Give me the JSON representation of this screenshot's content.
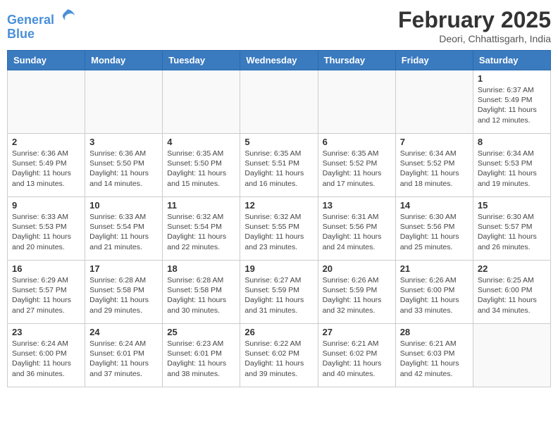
{
  "header": {
    "logo_line1": "General",
    "logo_line2": "Blue",
    "month_title": "February 2025",
    "subtitle": "Deori, Chhattisgarh, India"
  },
  "days_of_week": [
    "Sunday",
    "Monday",
    "Tuesday",
    "Wednesday",
    "Thursday",
    "Friday",
    "Saturday"
  ],
  "weeks": [
    [
      {
        "day": "",
        "info": ""
      },
      {
        "day": "",
        "info": ""
      },
      {
        "day": "",
        "info": ""
      },
      {
        "day": "",
        "info": ""
      },
      {
        "day": "",
        "info": ""
      },
      {
        "day": "",
        "info": ""
      },
      {
        "day": "1",
        "info": "Sunrise: 6:37 AM\nSunset: 5:49 PM\nDaylight: 11 hours\nand 12 minutes."
      }
    ],
    [
      {
        "day": "2",
        "info": "Sunrise: 6:36 AM\nSunset: 5:49 PM\nDaylight: 11 hours\nand 13 minutes."
      },
      {
        "day": "3",
        "info": "Sunrise: 6:36 AM\nSunset: 5:50 PM\nDaylight: 11 hours\nand 14 minutes."
      },
      {
        "day": "4",
        "info": "Sunrise: 6:35 AM\nSunset: 5:50 PM\nDaylight: 11 hours\nand 15 minutes."
      },
      {
        "day": "5",
        "info": "Sunrise: 6:35 AM\nSunset: 5:51 PM\nDaylight: 11 hours\nand 16 minutes."
      },
      {
        "day": "6",
        "info": "Sunrise: 6:35 AM\nSunset: 5:52 PM\nDaylight: 11 hours\nand 17 minutes."
      },
      {
        "day": "7",
        "info": "Sunrise: 6:34 AM\nSunset: 5:52 PM\nDaylight: 11 hours\nand 18 minutes."
      },
      {
        "day": "8",
        "info": "Sunrise: 6:34 AM\nSunset: 5:53 PM\nDaylight: 11 hours\nand 19 minutes."
      }
    ],
    [
      {
        "day": "9",
        "info": "Sunrise: 6:33 AM\nSunset: 5:53 PM\nDaylight: 11 hours\nand 20 minutes."
      },
      {
        "day": "10",
        "info": "Sunrise: 6:33 AM\nSunset: 5:54 PM\nDaylight: 11 hours\nand 21 minutes."
      },
      {
        "day": "11",
        "info": "Sunrise: 6:32 AM\nSunset: 5:54 PM\nDaylight: 11 hours\nand 22 minutes."
      },
      {
        "day": "12",
        "info": "Sunrise: 6:32 AM\nSunset: 5:55 PM\nDaylight: 11 hours\nand 23 minutes."
      },
      {
        "day": "13",
        "info": "Sunrise: 6:31 AM\nSunset: 5:56 PM\nDaylight: 11 hours\nand 24 minutes."
      },
      {
        "day": "14",
        "info": "Sunrise: 6:30 AM\nSunset: 5:56 PM\nDaylight: 11 hours\nand 25 minutes."
      },
      {
        "day": "15",
        "info": "Sunrise: 6:30 AM\nSunset: 5:57 PM\nDaylight: 11 hours\nand 26 minutes."
      }
    ],
    [
      {
        "day": "16",
        "info": "Sunrise: 6:29 AM\nSunset: 5:57 PM\nDaylight: 11 hours\nand 27 minutes."
      },
      {
        "day": "17",
        "info": "Sunrise: 6:28 AM\nSunset: 5:58 PM\nDaylight: 11 hours\nand 29 minutes."
      },
      {
        "day": "18",
        "info": "Sunrise: 6:28 AM\nSunset: 5:58 PM\nDaylight: 11 hours\nand 30 minutes."
      },
      {
        "day": "19",
        "info": "Sunrise: 6:27 AM\nSunset: 5:59 PM\nDaylight: 11 hours\nand 31 minutes."
      },
      {
        "day": "20",
        "info": "Sunrise: 6:26 AM\nSunset: 5:59 PM\nDaylight: 11 hours\nand 32 minutes."
      },
      {
        "day": "21",
        "info": "Sunrise: 6:26 AM\nSunset: 6:00 PM\nDaylight: 11 hours\nand 33 minutes."
      },
      {
        "day": "22",
        "info": "Sunrise: 6:25 AM\nSunset: 6:00 PM\nDaylight: 11 hours\nand 34 minutes."
      }
    ],
    [
      {
        "day": "23",
        "info": "Sunrise: 6:24 AM\nSunset: 6:00 PM\nDaylight: 11 hours\nand 36 minutes."
      },
      {
        "day": "24",
        "info": "Sunrise: 6:24 AM\nSunset: 6:01 PM\nDaylight: 11 hours\nand 37 minutes."
      },
      {
        "day": "25",
        "info": "Sunrise: 6:23 AM\nSunset: 6:01 PM\nDaylight: 11 hours\nand 38 minutes."
      },
      {
        "day": "26",
        "info": "Sunrise: 6:22 AM\nSunset: 6:02 PM\nDaylight: 11 hours\nand 39 minutes."
      },
      {
        "day": "27",
        "info": "Sunrise: 6:21 AM\nSunset: 6:02 PM\nDaylight: 11 hours\nand 40 minutes."
      },
      {
        "day": "28",
        "info": "Sunrise: 6:21 AM\nSunset: 6:03 PM\nDaylight: 11 hours\nand 42 minutes."
      },
      {
        "day": "",
        "info": ""
      }
    ]
  ]
}
